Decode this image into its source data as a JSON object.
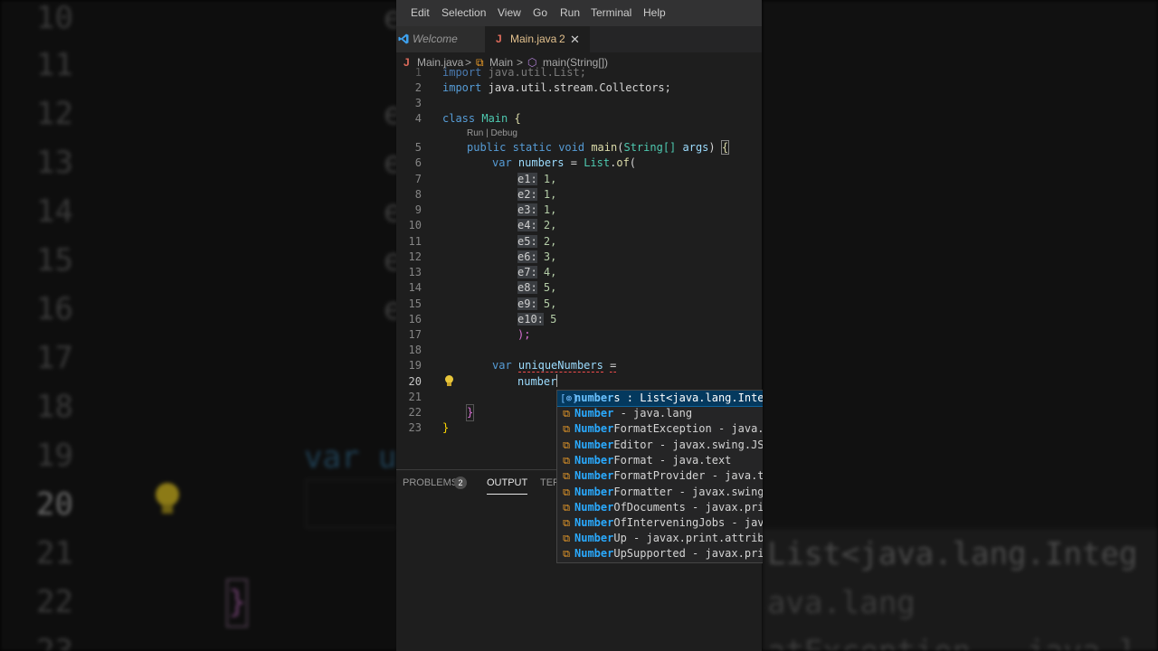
{
  "menu": [
    "Edit",
    "Selection",
    "View",
    "Go",
    "Run",
    "Terminal",
    "Help"
  ],
  "tabs": {
    "welcome": "Welcome",
    "main_icon": "J",
    "main": "Main.java",
    "main_problems": "2"
  },
  "breadcrumb": {
    "file_icon": "J",
    "file": "Main.java",
    "sep": ">",
    "class": "Main",
    "method": "main(String[])"
  },
  "editor": {
    "line_numbers": [
      "1",
      "2",
      "3",
      "4",
      "5",
      "6",
      "7",
      "8",
      "9",
      "10",
      "11",
      "12",
      "13",
      "14",
      "15",
      "16",
      "17",
      "18",
      "19",
      "20",
      "21",
      "22",
      "23"
    ],
    "codelens": "Run | Debug",
    "code": {
      "l1_import": "import",
      "l1_pkg": "java.util.List;",
      "l2_import": "import",
      "l2_pkg": "java.util.stream.Collectors;",
      "l4_class": "class",
      "l4_name": "Main",
      "l4_brace": "{",
      "l5_public": "public",
      "l5_static": "static",
      "l5_void": "void",
      "l5_main": "main",
      "l5_paren": "(",
      "l5_string": "String[]",
      "l5_args": "args",
      "l5_close": ")",
      "l5_brace": "{",
      "l6_var": "var",
      "l6_name": "numbers",
      "l6_eq": "=",
      "l6_list": "List",
      "l6_dot": ".",
      "l6_of": "of",
      "l6_paren": "(",
      "hints": [
        "e1:",
        "e2:",
        "e3:",
        "e4:",
        "e5:",
        "e6:",
        "e7:",
        "e8:",
        "e9:",
        "e10:"
      ],
      "values": [
        "1,",
        "1,",
        "1,",
        "2,",
        "2,",
        "3,",
        "4,",
        "5,",
        "5,",
        "5"
      ],
      "l17": ");",
      "l19_var": "var",
      "l19_name": "uniqueNumbers",
      "l19_eq": "=",
      "l20_text": "number",
      "l22": "}",
      "l23": "}"
    }
  },
  "panel": {
    "problems": "PROBLEMS",
    "problems_count": "2",
    "output": "OUTPUT",
    "terminal": "TER"
  },
  "suggestions": [
    {
      "icon": "field",
      "match": "number",
      "rest": "s : List<java.lang.Integ"
    },
    {
      "icon": "class",
      "match": "Number",
      "rest": " - java.lang"
    },
    {
      "icon": "class",
      "match": "Number",
      "rest": "FormatException - java.l"
    },
    {
      "icon": "class",
      "match": "Number",
      "rest": "Editor - javax.swing.JSp"
    },
    {
      "icon": "class",
      "match": "Number",
      "rest": "Format - java.text"
    },
    {
      "icon": "class",
      "match": "Number",
      "rest": "FormatProvider - java.te"
    },
    {
      "icon": "class",
      "match": "Number",
      "rest": "Formatter - javax.swing."
    },
    {
      "icon": "class",
      "match": "Number",
      "rest": "OfDocuments - javax.prin"
    },
    {
      "icon": "class",
      "match": "Number",
      "rest": "OfInterveningJobs - java"
    },
    {
      "icon": "class",
      "match": "Number",
      "rest": "Up - javax.print.attribu"
    },
    {
      "icon": "class",
      "match": "Number",
      "rest": "UpSupported - javax.prin"
    }
  ],
  "background": {
    "left_line_numbers": [
      "10",
      "11",
      "12",
      "13",
      "14",
      "15",
      "16",
      "17",
      "18",
      "19",
      "20",
      "21",
      "22",
      "23"
    ],
    "left_e": "e",
    "left_var": "var u",
    "left_brace": "}",
    "right_lines": [
      "List<java.lang.Integ",
      "ava.lang",
      "atException - java.l"
    ]
  },
  "icons": {
    "class_icon": "symbol-class",
    "field_icon": "symbol-field",
    "bulb": "lightbulb",
    "vscode": "vscode-logo"
  }
}
